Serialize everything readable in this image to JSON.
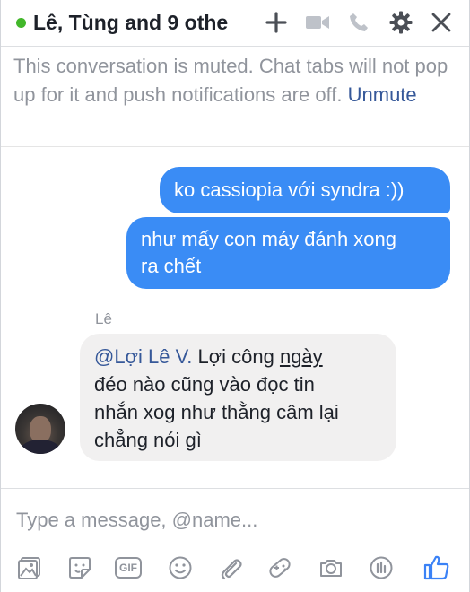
{
  "header": {
    "title": "Lê, Tùng and 9 othe",
    "icons": [
      "add-people-icon",
      "video-call-icon",
      "voice-call-icon",
      "gear-icon",
      "close-icon"
    ],
    "status_color": "#42b72a"
  },
  "muted_notice": {
    "text": "This conversation is muted. Chat tabs will not pop up for it and push notifications are off.",
    "unmute_label": "Unmute"
  },
  "messages": {
    "outgoing": [
      {
        "text": "ko cassiopia với syndra :))"
      },
      {
        "line1": "như mấy con máy đánh xong",
        "line2": "ra chết"
      }
    ],
    "incoming": {
      "sender": "Lê",
      "mention": "@Lợi Lê V.",
      "part1": " Lợi công ",
      "underlined": "ngày ",
      "line2": "đéo nào cũng vào đọc tin",
      "line3": "nhắn xog như thằng câm lại",
      "line4": "chẳng nói gì"
    }
  },
  "composer": {
    "placeholder": "Type a message, @name..."
  },
  "toolbar": {
    "gif_label": "GIF",
    "icons": [
      "photo-icon",
      "sticker-icon",
      "gif-icon",
      "emoji-icon",
      "attachment-icon",
      "game-icon",
      "camera-icon",
      "poll-icon",
      "like-icon"
    ]
  },
  "colors": {
    "outgoing_bubble": "#3a8cf5",
    "incoming_bubble": "#f1f0f0",
    "link": "#365899",
    "icon_gray": "#90949c",
    "like_blue": "#3b82f6"
  }
}
